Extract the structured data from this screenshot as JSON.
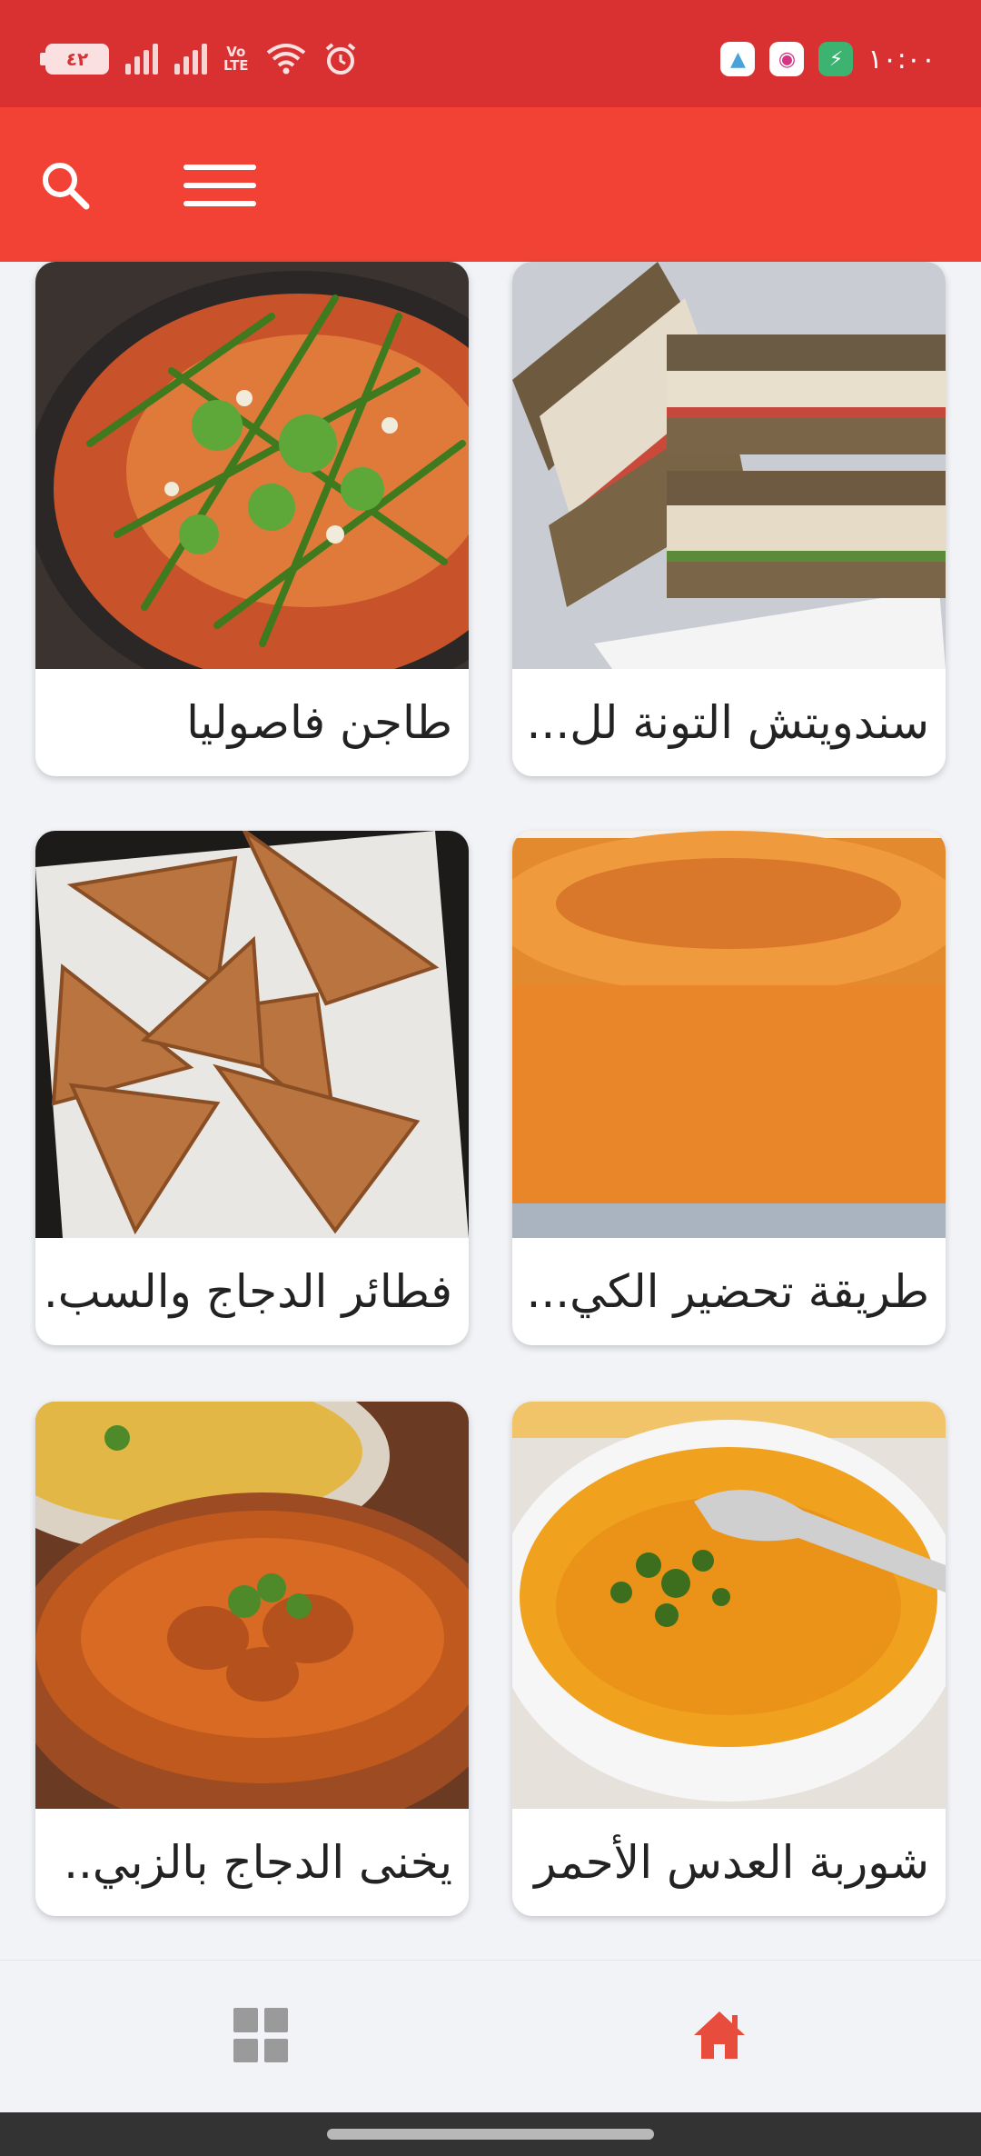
{
  "status_bar": {
    "battery_level": "٤٢",
    "network": [
      "Vo",
      "LTE"
    ],
    "time": "١٠:٠٠",
    "icons": [
      "battery-icon",
      "signal-icon",
      "signal-icon",
      "volte-icon",
      "wifi-icon",
      "alarm-icon",
      "app-notification-icon",
      "app-notification-icon",
      "shield-icon"
    ]
  },
  "toolbar": {
    "search_icon": "search-icon",
    "menu_icon": "hamburger-menu-icon",
    "background": "#f24236"
  },
  "recipes": [
    {
      "title": "سندويتش التونة لل...",
      "image": "tuna-sandwich"
    },
    {
      "title": "طاجن فاصوليا",
      "image": "green-beans-tagine"
    },
    {
      "title": "طريقة تحضير الكي...",
      "image": "orange-cake"
    },
    {
      "title": "فطائر الدجاج والسب.",
      "image": "chicken-pastries"
    },
    {
      "title": "شوربة العدس الأحمر",
      "image": "lentil-soup"
    },
    {
      "title": "يخنى الدجاج بالزبي..",
      "image": "chicken-stew"
    }
  ],
  "bottom_nav": {
    "items": [
      {
        "icon": "grid-icon",
        "active": false
      },
      {
        "icon": "home-icon",
        "active": true
      }
    ],
    "active_color": "#e84c3d",
    "inactive_color": "#9a9a9a"
  }
}
